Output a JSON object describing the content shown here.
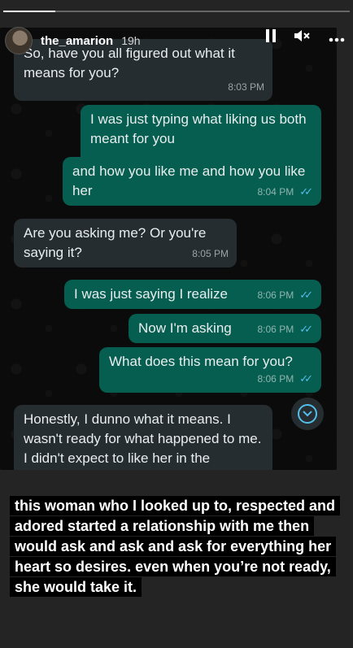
{
  "story": {
    "progress": 0.15,
    "username": "the_amarion",
    "time_ago": "19h",
    "pause_icon": "pause-icon",
    "mute_icon": "mute-icon",
    "more_icon": "more-icon"
  },
  "chat": {
    "messages": [
      {
        "type": "received",
        "text": "So, have you all figured out what it means for you?",
        "time": "8:03 PM"
      },
      {
        "type": "sent",
        "text": "I was just typing what liking us both meant for you",
        "time": "8:04 PM"
      },
      {
        "type": "sent",
        "text": "and how you like me and how you like her",
        "time": "8:04 PM"
      },
      {
        "type": "received",
        "text": "Are you asking me? Or you're saying it?",
        "time": "8:05 PM"
      },
      {
        "type": "sent",
        "text": "I was just saying I realize",
        "time": "8:06 PM"
      },
      {
        "type": "sent",
        "text": "Now I'm asking",
        "time": "8:06 PM"
      },
      {
        "type": "sent",
        "text": "What does this mean for you?",
        "time": "8:06 PM"
      },
      {
        "type": "received",
        "text": "Honestly, I dunno what it means. I wasn't ready for what happened to me. I didn't expect to like her in the",
        "time": ""
      }
    ],
    "scroll_icon": "chevron-down-icon",
    "tick_color": "#53bdeb",
    "sent_color": "#055e4f",
    "received_color": "#262d31"
  },
  "caption": {
    "text": "this woman who I looked up to, respected and adored started a relationship with me then would ask and ask and ask for everything her heart so desires. even when you’re not ready, she would take it."
  }
}
